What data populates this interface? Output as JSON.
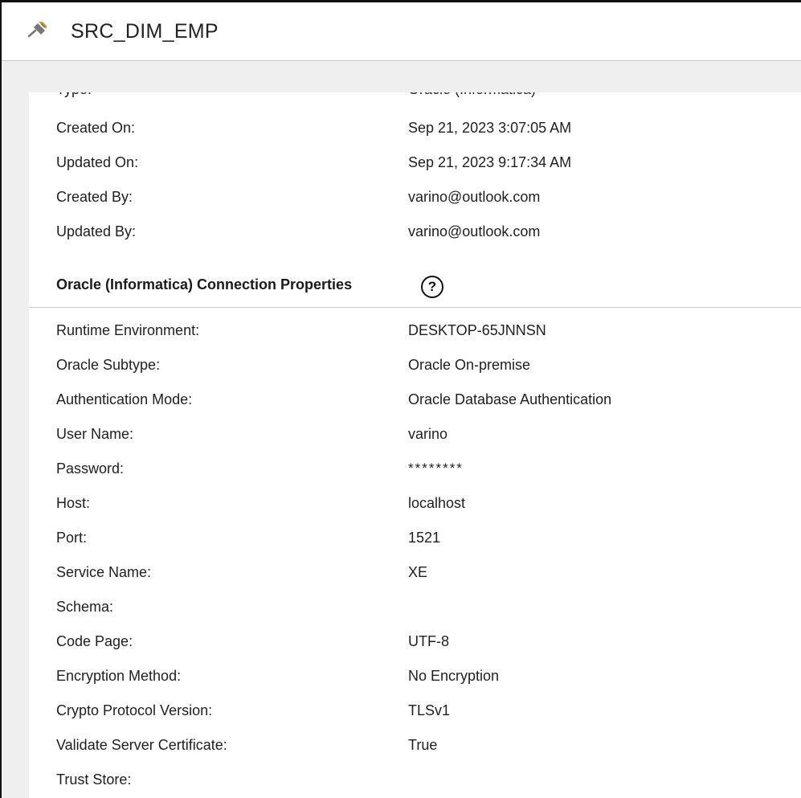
{
  "header": {
    "icon": "connection-plug-icon",
    "title": "SRC_DIM_EMP"
  },
  "general": {
    "rows": [
      {
        "label": "Type:",
        "value": "Oracle (Informatica)"
      },
      {
        "label": "Created On:",
        "value": "Sep 21, 2023 3:07:05 AM"
      },
      {
        "label": "Updated On:",
        "value": "Sep 21, 2023 9:17:34 AM"
      },
      {
        "label": "Created By:",
        "value": "varino@outlook.com"
      },
      {
        "label": "Updated By:",
        "value": "varino@outlook.com"
      }
    ]
  },
  "connection_properties": {
    "title": "Oracle (Informatica) Connection Properties",
    "help_icon": "help-question-icon",
    "help_glyph": "?",
    "rows": [
      {
        "label": "Runtime Environment:",
        "value": "DESKTOP-65JNNSN"
      },
      {
        "label": "Oracle Subtype:",
        "value": "Oracle On-premise"
      },
      {
        "label": "Authentication Mode:",
        "value": "Oracle Database Authentication"
      },
      {
        "label": "User Name:",
        "value": "varino"
      },
      {
        "label": "Password:",
        "value": "********"
      },
      {
        "label": "Host:",
        "value": "localhost"
      },
      {
        "label": "Port:",
        "value": "1521"
      },
      {
        "label": "Service Name:",
        "value": "XE"
      },
      {
        "label": "Schema:",
        "value": ""
      },
      {
        "label": "Code Page:",
        "value": "UTF-8"
      },
      {
        "label": "Encryption Method:",
        "value": "No Encryption"
      },
      {
        "label": "Crypto Protocol Version:",
        "value": "TLSv1"
      },
      {
        "label": "Validate Server Certificate:",
        "value": "True"
      },
      {
        "label": "Trust Store:",
        "value": ""
      }
    ]
  },
  "colors": {
    "panel_background": "#efefef",
    "content_background": "#ffffff",
    "text": "#1f1f1f"
  }
}
